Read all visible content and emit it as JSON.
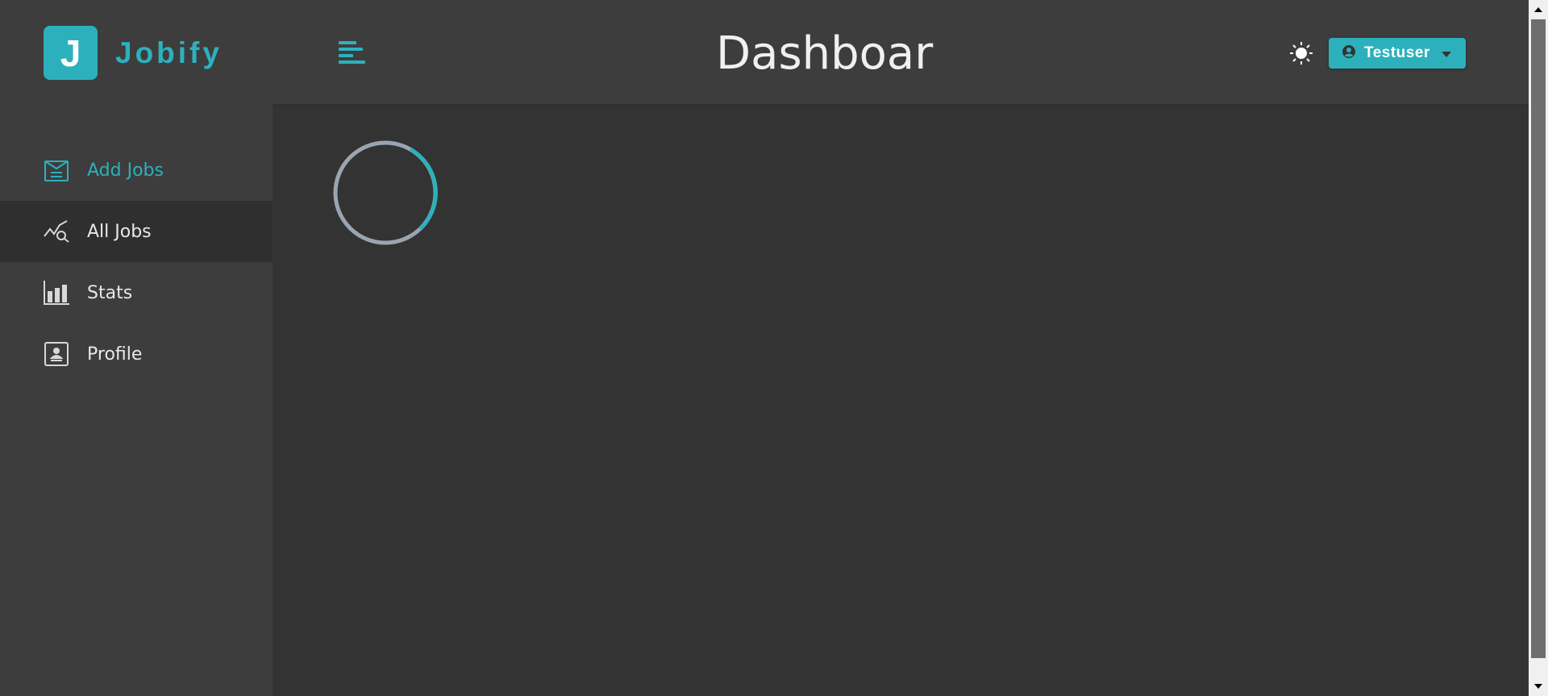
{
  "brand": {
    "logo_letter": "J",
    "name": "Jobify",
    "accent": "#2cb1bc"
  },
  "sidebar": {
    "items": [
      {
        "label": "Add Jobs",
        "icon": "add-job-icon",
        "state": "active"
      },
      {
        "label": "All Jobs",
        "icon": "all-jobs-icon",
        "state": "hover"
      },
      {
        "label": "Stats",
        "icon": "stats-icon",
        "state": "default"
      },
      {
        "label": "Profile",
        "icon": "profile-icon",
        "state": "default"
      }
    ]
  },
  "header": {
    "title": "Dashboar",
    "toggle_icon": "menu-toggle-icon",
    "theme_icon": "sun-icon",
    "user": {
      "name": "Testuser",
      "icon": "user-circle-icon",
      "dropdown_icon": "caret-down-icon"
    }
  },
  "main": {
    "loading": true,
    "spinner_icon": "loading-spinner-icon"
  },
  "colors": {
    "background": "#333333",
    "panel": "#3d3d3d",
    "hover": "#2f2f2f",
    "text": "#e8e8e8"
  }
}
